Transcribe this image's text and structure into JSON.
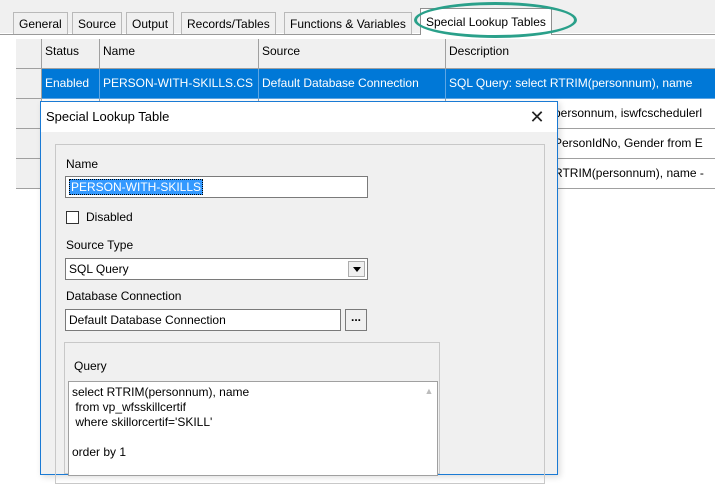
{
  "tabs": [
    "General",
    "Source",
    "Output",
    "Records/Tables",
    "Functions & Variables",
    "Special Lookup Tables"
  ],
  "active_tab": "Special Lookup Tables",
  "highlight_color": "#2aa08a",
  "grid": {
    "columns": [
      "Status",
      "Name",
      "Source",
      "Description"
    ],
    "rows": [
      {
        "status": "Enabled",
        "name": "PERSON-WITH-SKILLS.CS",
        "source": "Default Database Connection",
        "description": "SQL Query: select RTRIM(personnum), name"
      },
      {
        "status": "",
        "name": "",
        "source": "",
        "description": "personnum, iswfcschedulerl"
      },
      {
        "status": "",
        "name": "",
        "source": "",
        "description": "PersonIdNo, Gender from E"
      },
      {
        "status": "",
        "name": "",
        "source": "",
        "description": "RTRIM(personnum), name -"
      }
    ],
    "selection_color": "#0078d7"
  },
  "dialog": {
    "title": "Special Lookup Table",
    "name_label": "Name",
    "name_value": "PERSON-WITH-SKILLS",
    "disabled_label": "Disabled",
    "source_type_label": "Source Type",
    "source_type_value": "SQL Query",
    "db_connection_label": "Database Connection",
    "db_connection_value": "Default Database Connection",
    "browse_label": "...",
    "query_label": "Query",
    "query_text": "select RTRIM(personnum), name\n from vp_wfsskillcertif\n where skillorcertif='SKILL'\n\norder by 1"
  }
}
